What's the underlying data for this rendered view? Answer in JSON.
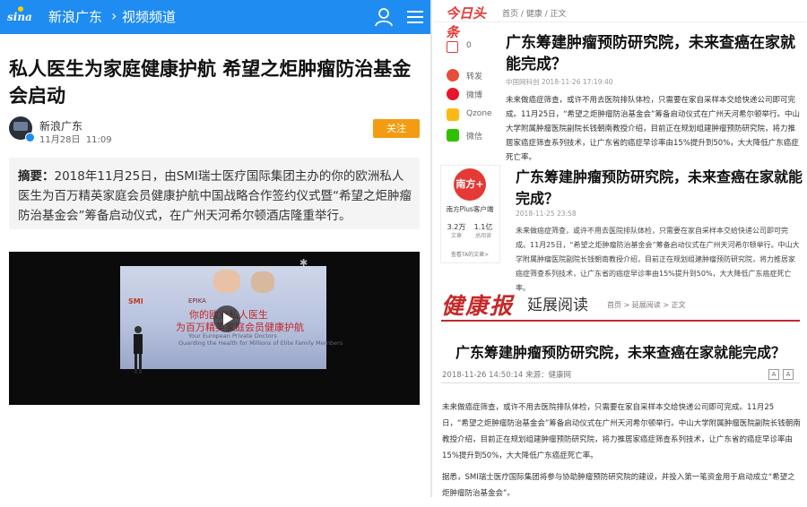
{
  "colors": {
    "sina_blue": "#1e8cf0",
    "follow_orange": "#f39c12",
    "toutiao_red": "#e53935",
    "health_red": "#c62828"
  },
  "left": {
    "topbar": {
      "logo": "sina",
      "crumb_1": "新浪广东",
      "crumb_sep": "›",
      "crumb_2": "视频频道",
      "icons": [
        "user-icon",
        "menu-icon"
      ]
    },
    "headline": "私人医生为家庭健康护航 希望之炬肿瘤防治基金会启动",
    "author": {
      "name": "新浪广东",
      "date": "11月28日",
      "time": "11:09"
    },
    "follow_label": "关注",
    "summary": {
      "label": "摘要：",
      "text": "2018年11月25日，由SMI瑞士医疗国际集团主办的你的欧洲私人医生为百万精英家庭会员健康护航中国战略合作签约仪式暨“希望之炬肿瘤防治基金会”筹备启动仪式，在广州天河希尔顿酒店隆重举行。"
    },
    "video": {
      "screen_logo_left": "SMI",
      "screen_logo_mid": "EPIKA",
      "line_1": "你的欧洲私人医生",
      "line_2": "为百万精英家庭会员健康护航",
      "line_3": "Your European Private Doctors",
      "line_4": "Guarding the Health for Millions of Elite Family Members"
    }
  },
  "toutiao": {
    "logo": "今日头条",
    "crumb": "首页 / 健康 / 正文",
    "share": [
      {
        "icon": "comment-icon",
        "label": "0"
      },
      {
        "icon": "repost-icon",
        "label": "转发"
      },
      {
        "icon": "weibo-icon",
        "label": "微博"
      },
      {
        "icon": "qzone-icon",
        "label": "Qzone"
      },
      {
        "icon": "wechat-icon",
        "label": "微信"
      }
    ],
    "title": "广东筹建肿瘤预防研究院，未来查癌在家就能完成？",
    "meta": "中国网科创   2018-11-26 17:19:40",
    "body": "未来做癌症筛查，或许不用去医院排队体检，只需要在家自采样本交给快递公司即可完成。11月25日，“希望之炬肿瘤防治基金会”筹备启动仪式在广州天河希尔顿举行。中山大学附属肿瘤医院副院长钱朝南教授介绍，目前正在规划组建肿瘤预防研究院，将力推居家癌症筛查系列技术，让广东省的癌症早诊率由15%提升到50%，大大降低广东癌症死亡率。"
  },
  "nanfang": {
    "logo": "南方+",
    "name": "南方Plus客户端",
    "stat_1": "3.2万",
    "stat_1_label": "文章",
    "stat_2": "1.1亿",
    "stat_2_label": "总阅读",
    "more": "查看TA的文章>",
    "title": "广东筹建肿瘤预防研究院，未来查癌在家就能完成？",
    "meta": "2018-11-25 23:58",
    "body": "未来做癌症筛查，或许不用去医院排队体检，只需要在家自采样本交给快递公司即可完成。11月25日，“希望之炬肿瘤防治基金会”筹备启动仪式在广州天河希尔顿举行。中山大学附属肿瘤医院副院长钱朝南教授介绍，目前正在规划组建肿瘤预防研究院，将力推居家癌症筛查系列技术，让广东省的癌症早诊率由15%提升到50%，大大降低广东癌症死亡率。"
  },
  "health": {
    "logo": "健康报",
    "subtitle": "延展阅读",
    "crumb": "首页 > 延展阅读 > 正文",
    "title": "广东筹建肿瘤预防研究院，未来查癌在家就能完成？",
    "meta": "2018-11-26 14:50:14      来源：健康网",
    "tool_a": "A",
    "tool_b": "A",
    "para_1": "未来做癌症筛查，或许不用去医院排队体检，只需要在家自采样本交给快递公司即可完成。11月25日，“希望之炬肿瘤防治基金会”筹备启动仪式在广州天河希尔顿举行。中山大学附属肿瘤医院副院长钱朝南教授介绍，目前正在规划组建肿瘤预防研究院，将力推居家癌症筛查系列技术，让广东省的癌症早诊率由15%提升到50%，大大降低广东癌症死亡率。",
    "para_2": "据悉，SMI瑞士医疗国际集团将参与协助肿瘤预防研究院的建设，并投入第一笔资金用于启动成立“希望之炬肿瘤防治基金会”。"
  }
}
